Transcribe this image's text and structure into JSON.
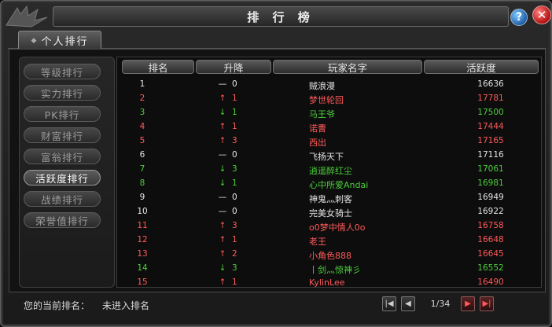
{
  "window": {
    "title": "排 行 榜",
    "help_label": "?",
    "close_label": "✕"
  },
  "tabs": [
    {
      "label": "个人排行"
    }
  ],
  "categories": [
    {
      "label": "等级排行",
      "active": false
    },
    {
      "label": "实力排行",
      "active": false
    },
    {
      "label": "PK排行",
      "active": false
    },
    {
      "label": "财富排行",
      "active": false
    },
    {
      "label": "富翁排行",
      "active": false
    },
    {
      "label": "活跃度排行",
      "active": true
    },
    {
      "label": "战绩排行",
      "active": false
    },
    {
      "label": "荣誉值排行",
      "active": false
    }
  ],
  "table": {
    "headers": {
      "rank": "排名",
      "change": "升降",
      "name": "玩家名字",
      "activity": "活跃度"
    },
    "rows": [
      {
        "rank": "1",
        "dir": "none",
        "change": "0",
        "name": "贼浪漫",
        "activity": "16636"
      },
      {
        "rank": "2",
        "dir": "up",
        "change": "1",
        "name": "梦世轮回",
        "activity": "17781"
      },
      {
        "rank": "3",
        "dir": "down",
        "change": "1",
        "name": "马王爷",
        "activity": "17500"
      },
      {
        "rank": "4",
        "dir": "up",
        "change": "1",
        "name": "诺曹",
        "activity": "17444"
      },
      {
        "rank": "5",
        "dir": "up",
        "change": "3",
        "name": "西出",
        "activity": "17165"
      },
      {
        "rank": "6",
        "dir": "none",
        "change": "0",
        "name": "飞扬天下",
        "activity": "17116"
      },
      {
        "rank": "7",
        "dir": "down",
        "change": "3",
        "name": "逍遥醉红尘",
        "activity": "17061"
      },
      {
        "rank": "8",
        "dir": "down",
        "change": "1",
        "name": "心中所爱Andai",
        "activity": "16981"
      },
      {
        "rank": "9",
        "dir": "none",
        "change": "0",
        "name": "神鬼灬刺客",
        "activity": "16949"
      },
      {
        "rank": "10",
        "dir": "none",
        "change": "0",
        "name": "完美女骑士",
        "activity": "16922"
      },
      {
        "rank": "11",
        "dir": "up",
        "change": "3",
        "name": "o0梦中情人0o",
        "activity": "16758"
      },
      {
        "rank": "12",
        "dir": "up",
        "change": "1",
        "name": "老王",
        "activity": "16648"
      },
      {
        "rank": "13",
        "dir": "up",
        "change": "2",
        "name": "小角色888",
        "activity": "16645"
      },
      {
        "rank": "14",
        "dir": "down",
        "change": "3",
        "name": "丨剑灬惊神彡",
        "activity": "16552"
      },
      {
        "rank": "15",
        "dir": "up",
        "change": "1",
        "name": "KylinLee",
        "activity": "16490"
      }
    ]
  },
  "footer": {
    "current_rank_label": "您的当前排名：",
    "current_rank_value": "未进入排名",
    "page": "1/34",
    "first_label": "|◀",
    "prev_label": "◀",
    "next_label": "▶",
    "last_label": "▶|"
  },
  "colors": {
    "up": "#ff5a5a",
    "down": "#4ccf3a",
    "none": "#e6e6e6"
  },
  "icons": {
    "up": "↑",
    "down": "↓",
    "none": "—"
  }
}
